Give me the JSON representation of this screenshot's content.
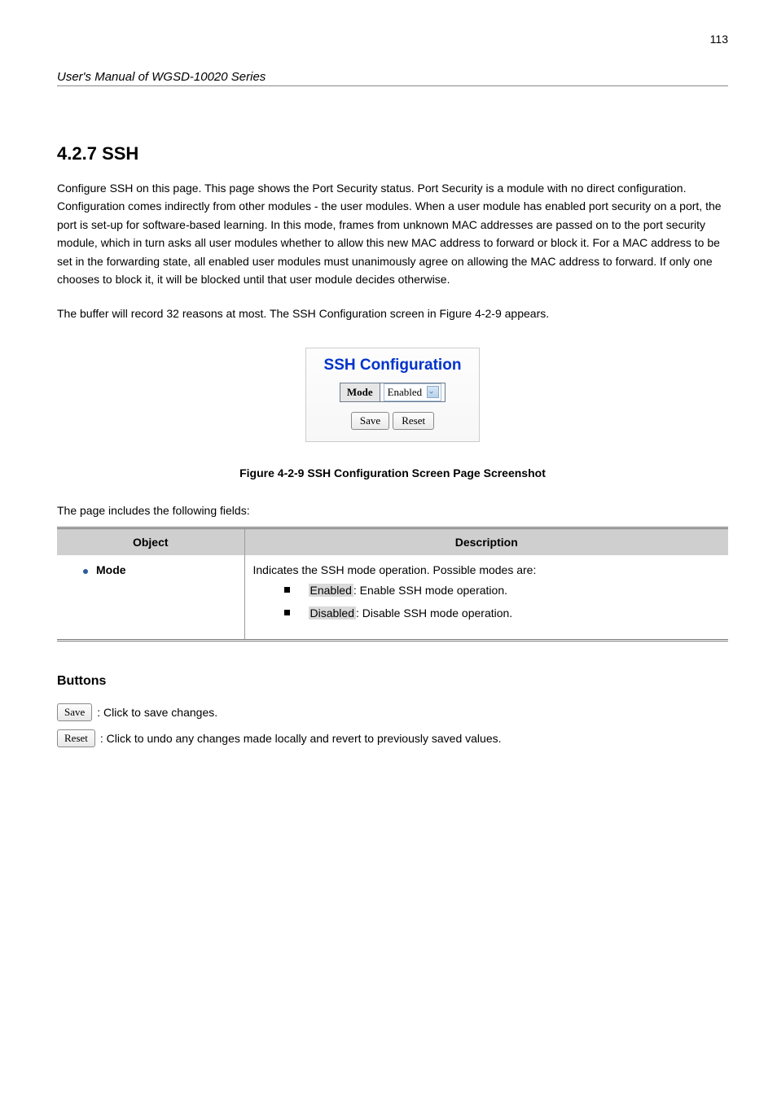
{
  "header": {
    "page_number": "113",
    "manual_title": "User's Manual of WGSD-10020 Series"
  },
  "section": {
    "number": "4.2.7",
    "title": "SSH"
  },
  "intro": "Configure SSH on this page. This page shows the Port Security status. Port Security is a module with no direct configuration. Configuration comes indirectly from other modules - the user modules. When a user module has enabled port security on a port, the port is set-up for software-based learning. In this mode, frames from unknown MAC addresses are passed on to the port security module, which in turn asks all user modules whether to allow this new MAC address to forward or block it. For a MAC address to be set in the forwarding state, all enabled user modules must unanimously agree on allowing the MAC address to forward. If only one chooses to block it, it will be blocked until that user module decides otherwise.",
  "intro_tail": "The buffer will record 32 reasons at most. The SSH Configuration screen in Figure 4-2-9 appears.",
  "ssh_panel": {
    "title": "SSH Configuration",
    "mode_label": "Mode",
    "mode_value": "Enabled",
    "save_label": "Save",
    "reset_label": "Reset"
  },
  "figure_caption": "Figure 4-2-9 SSH Configuration Screen Page Screenshot",
  "table_intro": "The page includes the following fields:",
  "table": {
    "head_object": "Object",
    "head_description": "Description",
    "row": {
      "object": "Mode",
      "desc_lead": "Indicates the SSH mode operation. Possible modes are:",
      "enabled_label": "Enabled",
      "enabled_tail": ": Enable SSH mode operation.",
      "disabled_label": "Disabled",
      "disabled_tail": ": Disable SSH mode operation."
    }
  },
  "buttons": {
    "heading": "Buttons",
    "save_btn": "Save",
    "save_text": ": Click to save changes.",
    "reset_btn": "Reset",
    "reset_text": ": Click to undo any changes made locally and revert to previously saved values."
  }
}
